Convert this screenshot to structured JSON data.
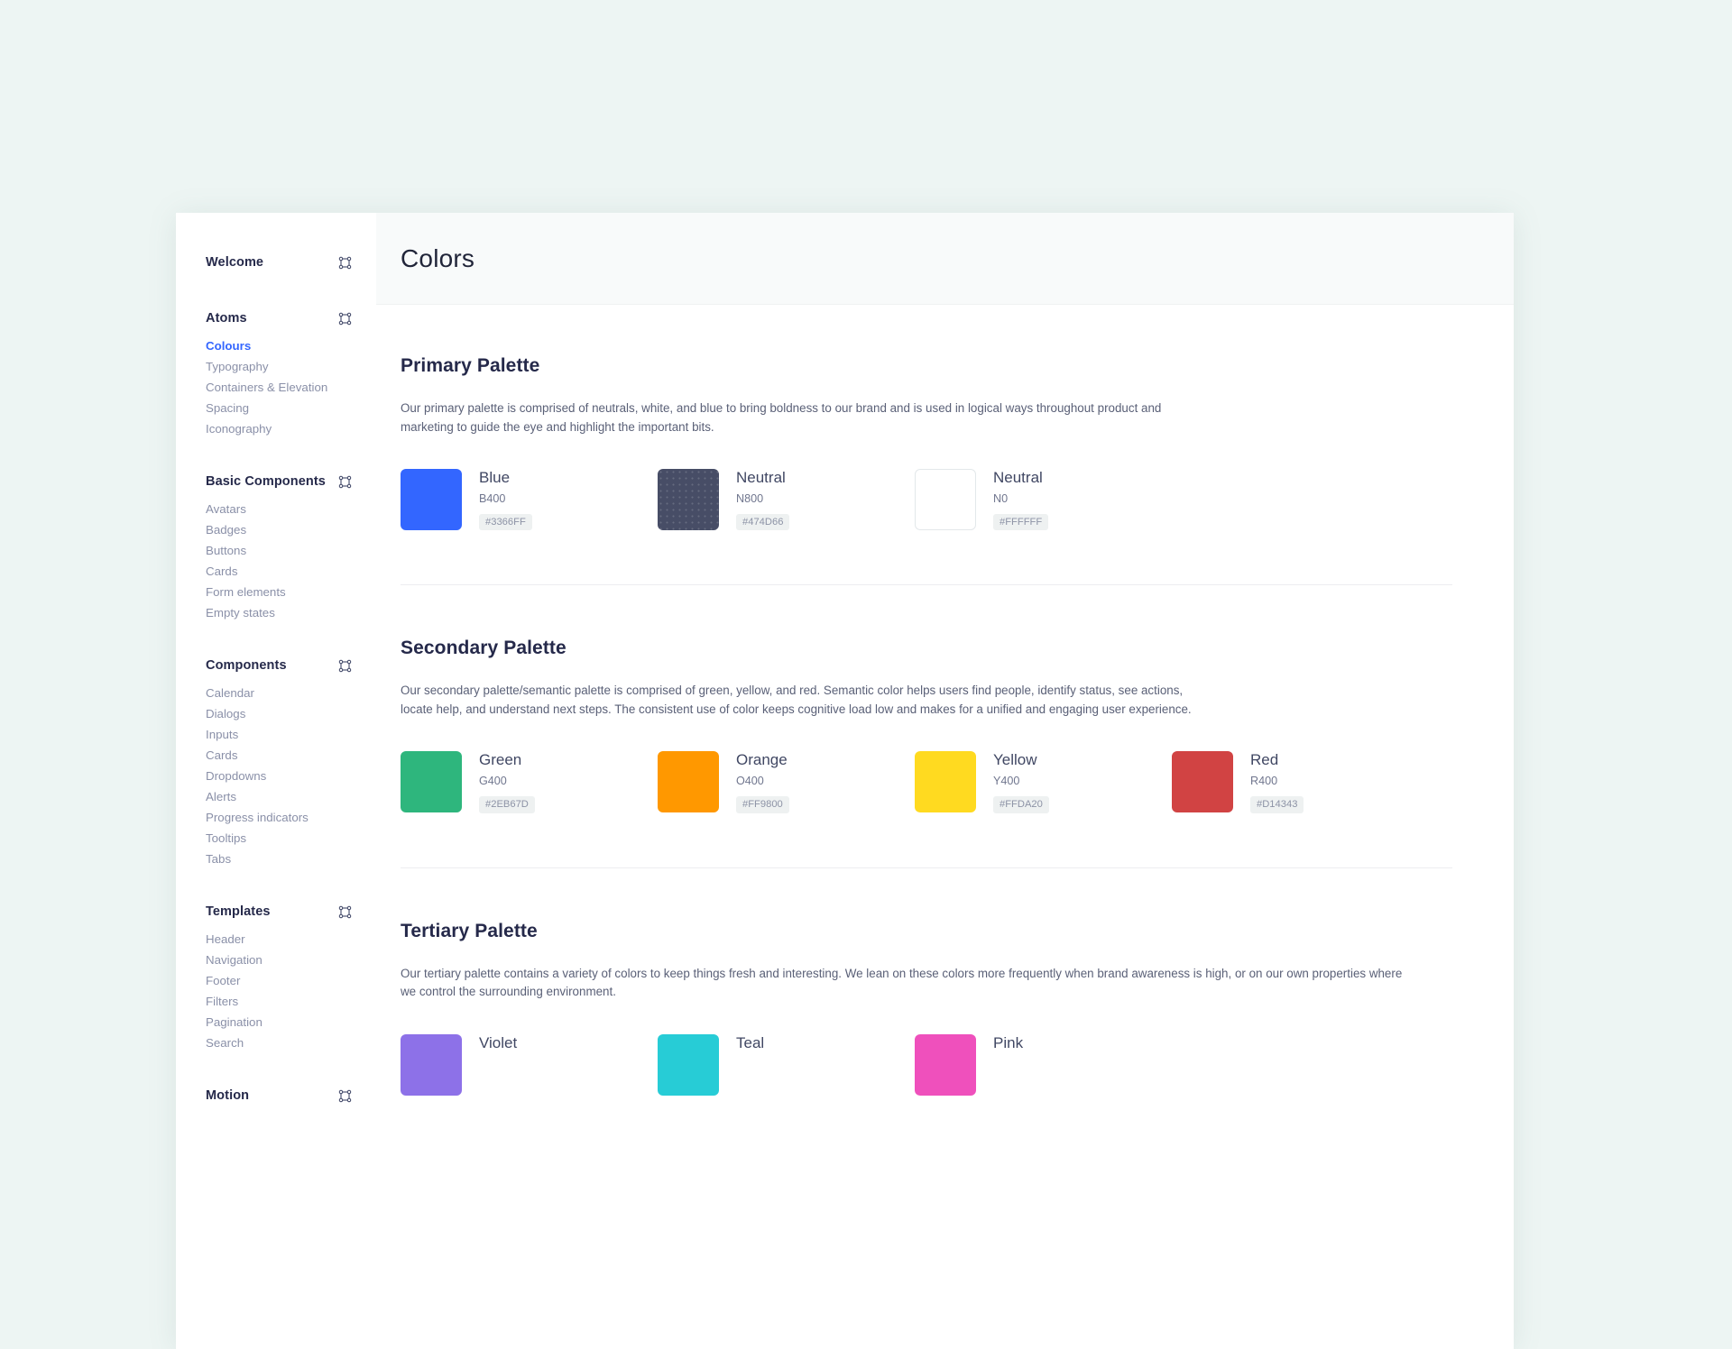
{
  "theme": {
    "page_background": "#EDF5F3",
    "card_background": "#FFFFFF",
    "header_background": "#F8FAFA",
    "accent": "#3366FF",
    "heading_color": "#25294A",
    "muted_text": "#8A90A8"
  },
  "header": {
    "title": "Colors"
  },
  "sidebar": {
    "groups": [
      {
        "title": "Welcome",
        "icon": "frame-icon",
        "items": []
      },
      {
        "title": "Atoms",
        "icon": "frame-icon",
        "items": [
          {
            "label": "Colours",
            "active": true
          },
          {
            "label": "Typography",
            "active": false
          },
          {
            "label": "Containers & Elevation",
            "active": false
          },
          {
            "label": "Spacing",
            "active": false
          },
          {
            "label": "Iconography",
            "active": false
          }
        ]
      },
      {
        "title": "Basic Components",
        "icon": "frame-icon",
        "items": [
          {
            "label": "Avatars",
            "active": false
          },
          {
            "label": "Badges",
            "active": false
          },
          {
            "label": "Buttons",
            "active": false
          },
          {
            "label": "Cards",
            "active": false
          },
          {
            "label": "Form elements",
            "active": false
          },
          {
            "label": "Empty states",
            "active": false
          }
        ]
      },
      {
        "title": "Components",
        "icon": "frame-icon",
        "items": [
          {
            "label": "Calendar",
            "active": false
          },
          {
            "label": "Dialogs",
            "active": false
          },
          {
            "label": "Inputs",
            "active": false
          },
          {
            "label": "Cards",
            "active": false
          },
          {
            "label": "Dropdowns",
            "active": false
          },
          {
            "label": "Alerts",
            "active": false
          },
          {
            "label": "Progress indicators",
            "active": false
          },
          {
            "label": "Tooltips",
            "active": false
          },
          {
            "label": "Tabs",
            "active": false
          }
        ]
      },
      {
        "title": "Templates",
        "icon": "frame-icon",
        "items": [
          {
            "label": "Header",
            "active": false
          },
          {
            "label": "Navigation",
            "active": false
          },
          {
            "label": "Footer",
            "active": false
          },
          {
            "label": "Filters",
            "active": false
          },
          {
            "label": "Pagination",
            "active": false
          },
          {
            "label": "Search",
            "active": false
          }
        ]
      },
      {
        "title": "Motion",
        "icon": "frame-icon",
        "items": []
      }
    ]
  },
  "sections": [
    {
      "title": "Primary Palette",
      "description": "Our primary palette is comprised of neutrals, white, and blue to bring boldness to our brand and is used in logical ways throughout product and marketing to guide the eye and highlight the important bits.",
      "swatches": [
        {
          "name": "Blue",
          "token": "B400",
          "hex": "#3366FF",
          "style": "solid"
        },
        {
          "name": "Neutral",
          "token": "N800",
          "hex": "#474D66",
          "style": "textured"
        },
        {
          "name": "Neutral",
          "token": "N0",
          "hex": "#FFFFFF",
          "style": "bordered"
        }
      ]
    },
    {
      "title": "Secondary Palette",
      "description": "Our secondary palette/semantic palette is comprised of green, yellow, and red. Semantic color helps users find people, identify status, see actions, locate help, and understand next steps. The consistent use of color keeps cognitive load low and makes for a unified and engaging user experience.",
      "swatches": [
        {
          "name": "Green",
          "token": "G400",
          "hex": "#2EB67D",
          "style": "solid"
        },
        {
          "name": "Orange",
          "token": "O400",
          "hex": "#FF9800",
          "style": "solid"
        },
        {
          "name": "Yellow",
          "token": "Y400",
          "hex": "#FFDA20",
          "style": "solid"
        },
        {
          "name": "Red",
          "token": "R400",
          "hex": "#D14343",
          "style": "solid"
        }
      ]
    },
    {
      "title": "Tertiary Palette",
      "description": "Our tertiary palette contains a variety of colors to keep things fresh and interesting. We lean on these colors more frequently when brand awareness is high, or on our own properties where we control the surrounding environment.",
      "swatches": [
        {
          "name": "Violet",
          "token": "",
          "hex": "#8D71E8",
          "style": "solid"
        },
        {
          "name": "Teal",
          "token": "",
          "hex": "#27CCD6",
          "style": "solid"
        },
        {
          "name": "Pink",
          "token": "",
          "hex": "#EF50BC",
          "style": "solid"
        }
      ]
    }
  ]
}
